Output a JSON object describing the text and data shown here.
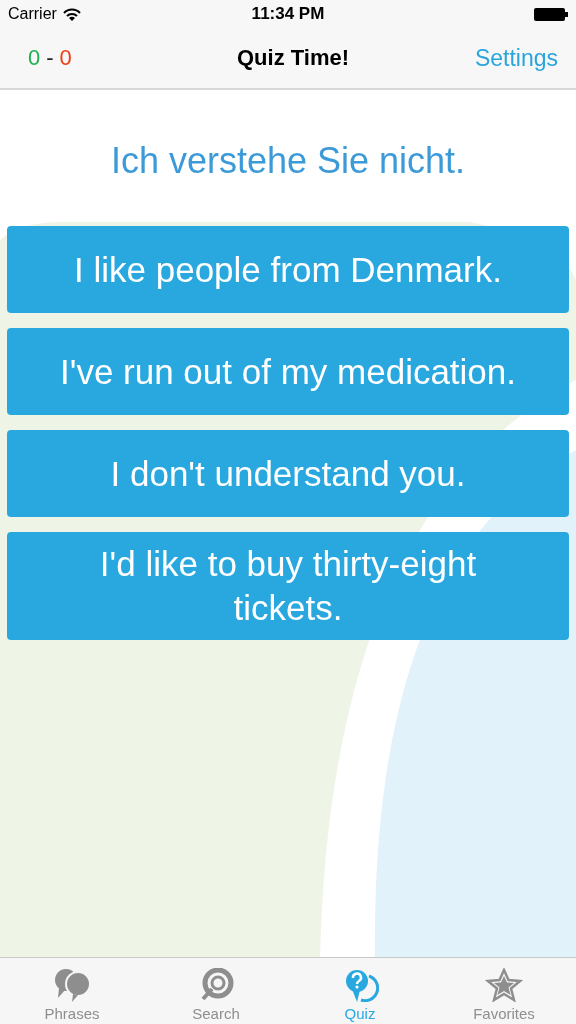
{
  "status_bar": {
    "carrier": "Carrier",
    "time": "11:34 PM"
  },
  "nav": {
    "score": {
      "correct": "0",
      "separator": "-",
      "wrong": "0"
    },
    "title": "Quiz Time!",
    "settings": "Settings"
  },
  "question": "Ich verstehe Sie nicht.",
  "answers": [
    "I like people from Denmark.",
    "I've run out of my medication.",
    "I don't understand you.",
    "I'd like to buy thirty-eight tickets."
  ],
  "tabs": [
    {
      "label": "Phrases",
      "kind": "phrases",
      "selected": false
    },
    {
      "label": "Search",
      "kind": "search",
      "selected": false
    },
    {
      "label": "Quiz",
      "kind": "quiz",
      "selected": true
    },
    {
      "label": "Favorites",
      "kind": "favorites",
      "selected": false
    }
  ]
}
